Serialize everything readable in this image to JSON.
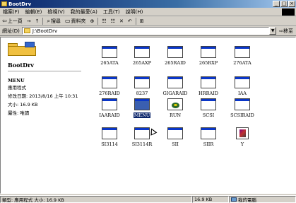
{
  "window": {
    "title": "BootDrv",
    "min": "_",
    "max": "□",
    "close": "×"
  },
  "menu": [
    "檔案(F)",
    "編輯(E)",
    "檢視(V)",
    "我的最愛(A)",
    "工具(T)",
    "說明(H)"
  ],
  "toolbar": {
    "back": "上一頁",
    "forward": "→",
    "up": "↑",
    "search": "搜尋",
    "folders": "資料夾",
    "history": "⊕",
    "move": "☷",
    "copy": "☷",
    "delete": "✕",
    "undo": "↶",
    "views": "⊞"
  },
  "address": {
    "label": "網址(D)",
    "value": "J:\\BootDrv",
    "go": "移至"
  },
  "left_pane": {
    "folder_title": "BootDrv",
    "item_name": "MENU",
    "item_type": "應用程式",
    "modified": "修改日期: 2013/8/16 上午 10:31",
    "size": "大小: 16.9 KB",
    "attributes": "屬性: 唯讀"
  },
  "files": [
    {
      "label": "265ATA",
      "kind": "window"
    },
    {
      "label": "265AXP",
      "kind": "window"
    },
    {
      "label": "265RAID",
      "kind": "window"
    },
    {
      "label": "265RXP",
      "kind": "window"
    },
    {
      "label": "276ATA",
      "kind": "window"
    },
    {
      "label": "276RAID",
      "kind": "window"
    },
    {
      "label": "8237",
      "kind": "window"
    },
    {
      "label": "GIGARAID",
      "kind": "window"
    },
    {
      "label": "HRRAID",
      "kind": "window"
    },
    {
      "label": "IAA",
      "kind": "window"
    },
    {
      "label": "IAARAID",
      "kind": "window"
    },
    {
      "label": "MENU",
      "kind": "selected"
    },
    {
      "label": "RUN",
      "kind": "cd"
    },
    {
      "label": "SCSI",
      "kind": "window"
    },
    {
      "label": "SCSIRAID",
      "kind": "window"
    },
    {
      "label": "SI3114",
      "kind": "window"
    },
    {
      "label": "SI3114R",
      "kind": "window"
    },
    {
      "label": "SII",
      "kind": "window"
    },
    {
      "label": "SIIR",
      "kind": "window"
    },
    {
      "label": "Y",
      "kind": "y"
    }
  ],
  "status": {
    "left": "類型: 應用程式 大小: 16.9 KB",
    "size": "16.9 KB",
    "zone": "我的電腦"
  }
}
